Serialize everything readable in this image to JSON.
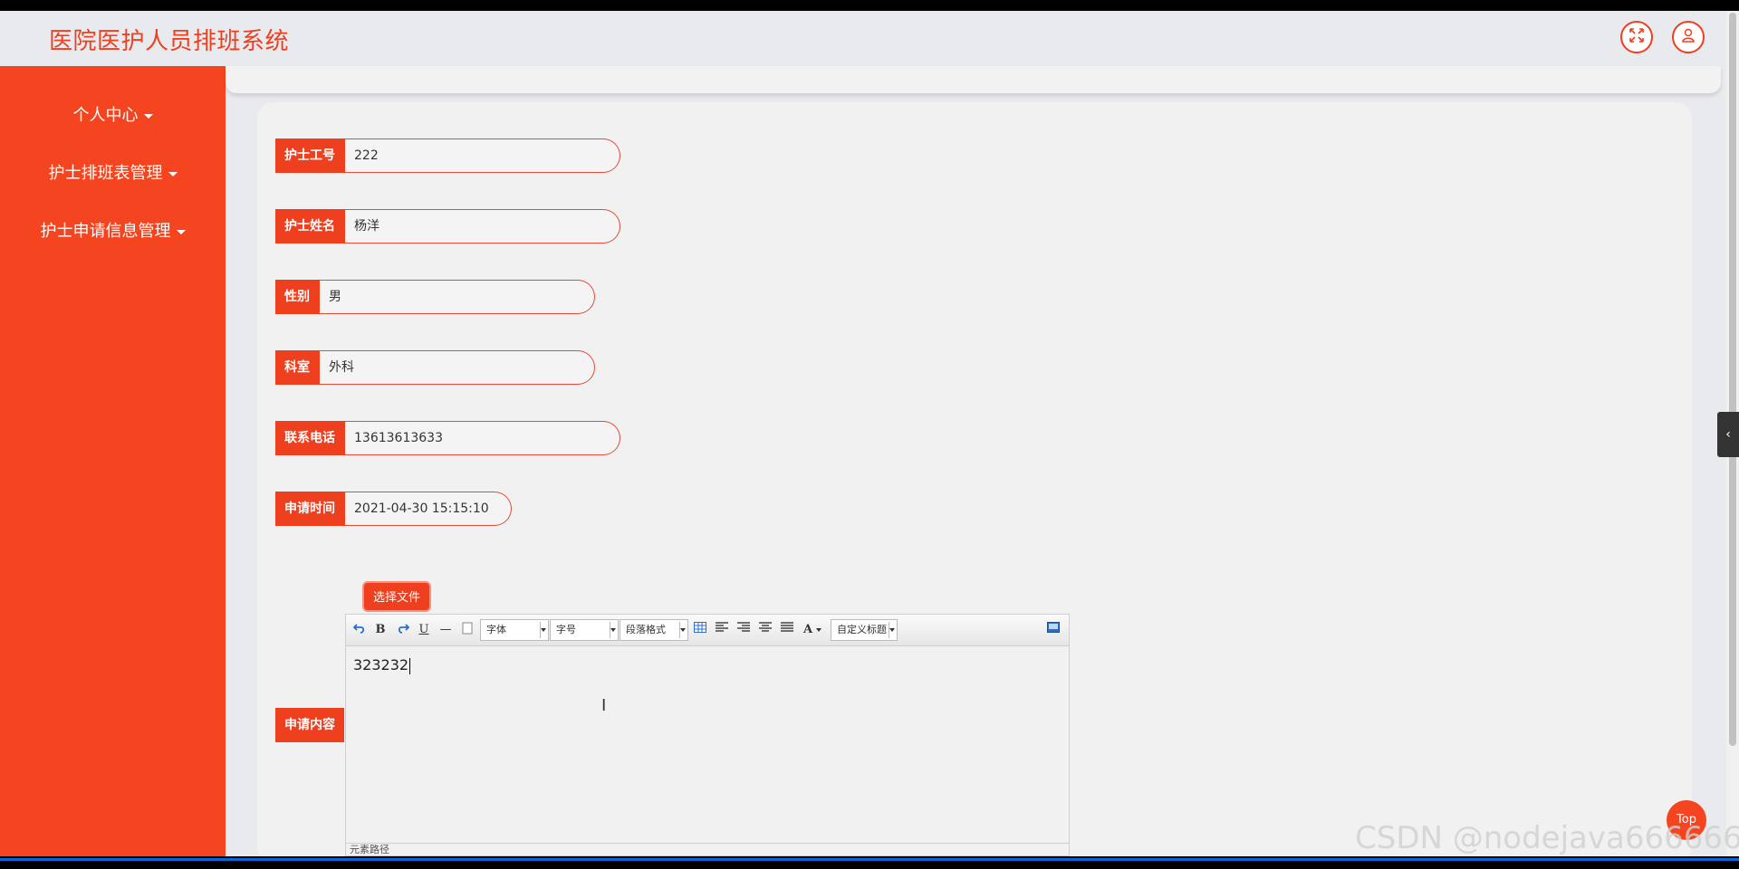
{
  "app": {
    "title": "医院医护人员排班系统",
    "accent_color": "#f44520",
    "header_buttons": [
      {
        "icon": "fullscreen-icon"
      },
      {
        "icon": "user-icon"
      }
    ]
  },
  "sidebar": {
    "items": [
      {
        "label": "个人中心"
      },
      {
        "label": "护士排班表管理"
      },
      {
        "label": "护士申请信息管理"
      }
    ]
  },
  "form": {
    "fields": [
      {
        "label": "护士工号",
        "value": "222"
      },
      {
        "label": "护士姓名",
        "value": "杨洋"
      },
      {
        "label": "性别",
        "value": "男"
      },
      {
        "label": "科室",
        "value": "外科"
      },
      {
        "label": "联系电话",
        "value": "13613613633"
      },
      {
        "label": "申请时间",
        "value": "2021-04-30 15:15:10"
      }
    ],
    "content_label": "申请内容",
    "choose_file_label": "选择文件"
  },
  "editor": {
    "toolbar": {
      "bold": "B",
      "underline": "U",
      "hr": "—",
      "font_color": "A",
      "font_select": "字体",
      "size_select": "字号",
      "paragraph_select": "段落格式",
      "custom_title_select": "自定义标题"
    },
    "content": "323232",
    "element_path": "元素路径"
  },
  "top_button": "Top",
  "watermark": "CSDN @nodejava666666"
}
